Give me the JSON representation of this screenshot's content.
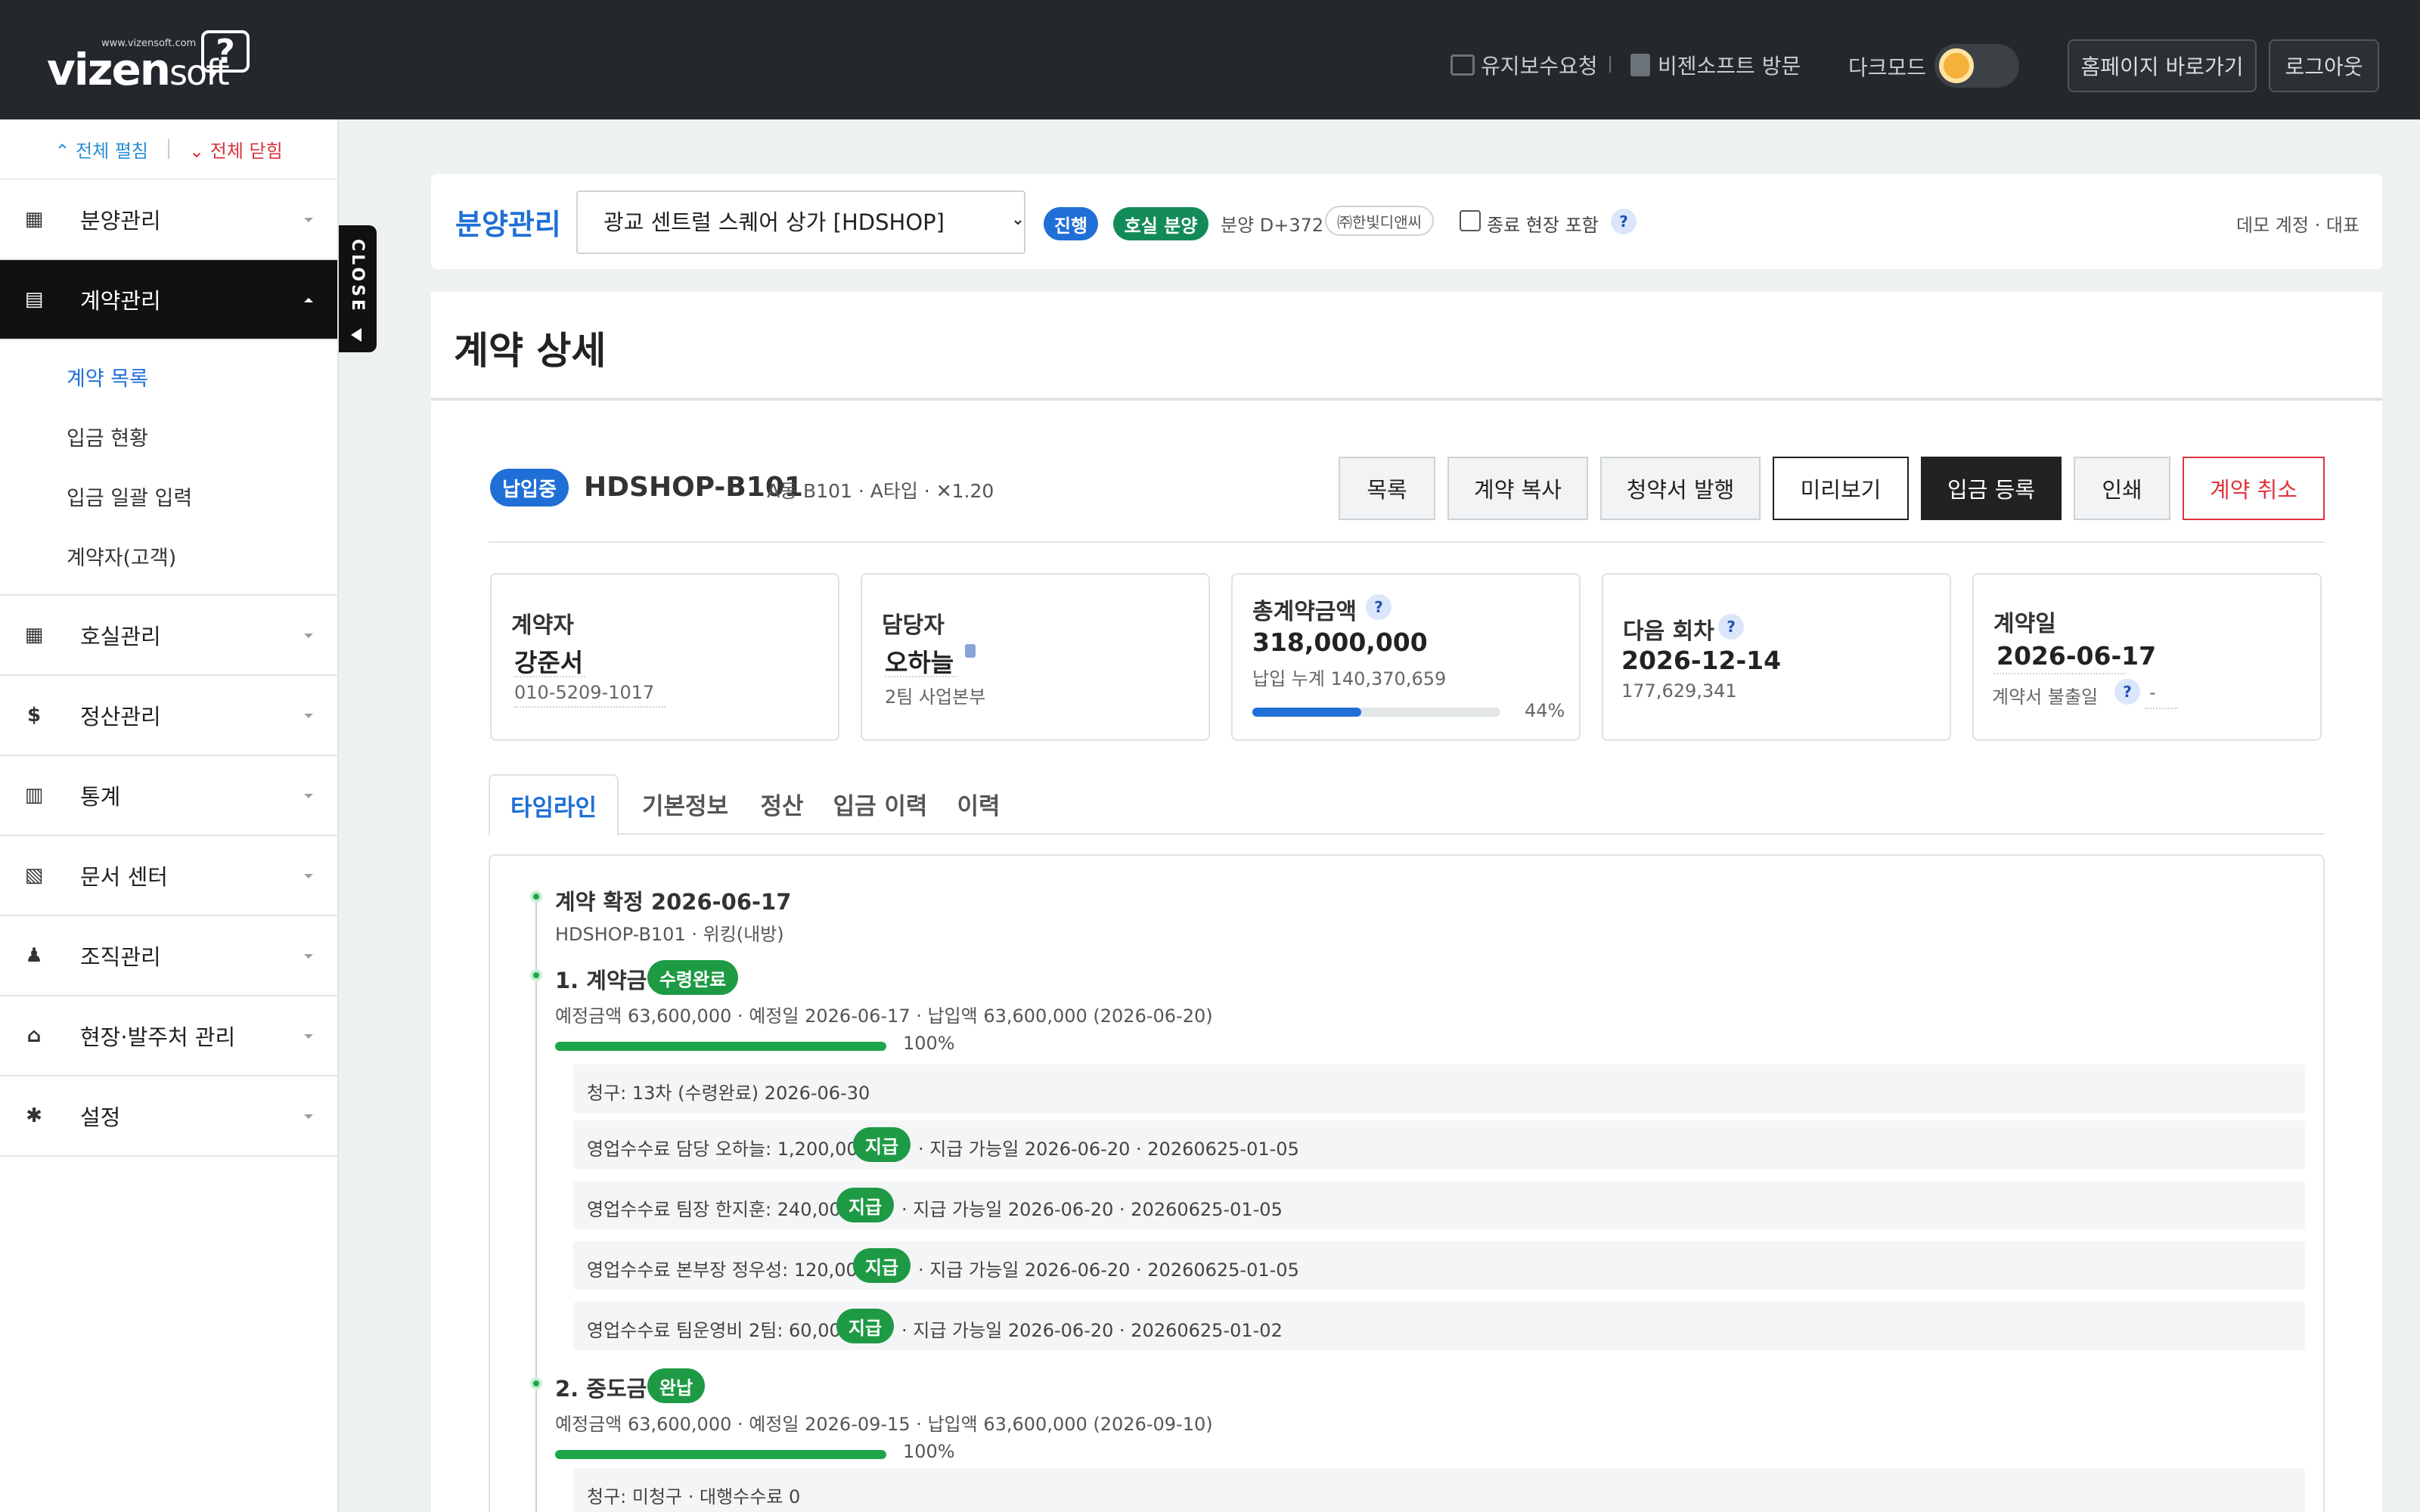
{
  "topbar": {
    "logo_small": "www.vizensoft.com",
    "logo_main": "vizen",
    "logo_soft": "soft",
    "logo_q": "?",
    "maintenance": "유지보수요청",
    "visit": "비젠소프트 방문",
    "darkmode_label": "다크모드",
    "homepage": "홈페이지 바로가기",
    "logout": "로그아웃"
  },
  "sidebar": {
    "expand_all": "⌃ 전체 펼침",
    "collapse_all": "⌄ 전체 닫힘",
    "items": [
      {
        "label": "분양관리",
        "icon": "building-icon"
      },
      {
        "label": "계약관리",
        "icon": "document-icon"
      },
      {
        "label": "호실관리",
        "icon": "grid-icon"
      },
      {
        "label": "정산관리",
        "icon": "dollar-icon"
      },
      {
        "label": "통계",
        "icon": "bar-chart-icon"
      },
      {
        "label": "문서 센터",
        "icon": "pdf-icon"
      },
      {
        "label": "조직관리",
        "icon": "people-icon"
      },
      {
        "label": "현장·발주처 관리",
        "icon": "bank-icon"
      },
      {
        "label": "설정",
        "icon": "settings-icon"
      }
    ],
    "sub": [
      "계약 목록",
      "입금 현황",
      "입금 일괄 입력",
      "계약자(고객)"
    ],
    "close_tab": "CLOSE"
  },
  "header": {
    "title": "분양관리",
    "site_selected": "광교 센트럴 스퀘어 상가 [HDSHOP]",
    "pill_progress": "진행",
    "pill_sale": "호실 분양",
    "dplus": "분양 D+372",
    "corp": "㈜한빛디앤씨",
    "include_closed": "종료 현장 포함",
    "help": "?",
    "account": "데모 계정 · 대표"
  },
  "page": {
    "title": "계약 상세",
    "status": "납입중",
    "code": "HDSHOP-B101",
    "code_meta": "A동 B101 · A타입 · ✕1.20",
    "buttons": [
      "목록",
      "계약 복사",
      "청약서 발행",
      "미리보기",
      "입금 등록",
      "인쇄",
      "계약 취소"
    ]
  },
  "summary": {
    "contractor_label": "계약자",
    "contractor_name": "강준서",
    "contractor_phone": "010-5209-1017",
    "manager_label": "담당자",
    "manager_name": "오하늘",
    "manager_team": "2팀 사업본부",
    "total_label": "총계약금액",
    "total_value": "318,000,000",
    "paid_sum": "납입 누계 140,370,659",
    "paid_ratio": 0.44,
    "paid_pct": "44%",
    "next_label": "다음 회차",
    "next_date": "2026-12-14",
    "next_amount": "177,629,341",
    "contract_label": "계약일",
    "contract_date": "2026-06-17",
    "contract_submit": "계약서 불출일",
    "contract_submit_val": "-"
  },
  "tabs": [
    "타임라인",
    "기본정보",
    "정산",
    "입금 이력",
    "이력"
  ],
  "timeline": {
    "confirm_title": "계약 확정 2026-06-17",
    "confirm_meta": "HDSHOP-B101 · 위킹(내방)",
    "s1_title": "1. 계약금",
    "s1_badge": "수령완료",
    "s1_meta": "예정금액 63,600,000 · 예정일 2026-06-17 · 납입액 63,600,000 (2026-06-20)",
    "s1_pct": "100%",
    "s1_ratio": 1.0,
    "s1_rows": [
      {
        "text": "청구: 13차 (수령완료) 2026-06-30"
      },
      {
        "text": "영업수수료 담당 오하늘: 1,200,000",
        "badge": "지급",
        "tail": "· 지급 가능일 2026-06-20 · 20260625-01-05"
      },
      {
        "text": "영업수수료 팀장 한지훈: 240,000",
        "badge": "지급",
        "tail": "· 지급 가능일 2026-06-20 · 20260625-01-05"
      },
      {
        "text": "영업수수료 본부장 정우성: 120,000",
        "badge": "지급",
        "tail": "· 지급 가능일 2026-06-20 · 20260625-01-05"
      },
      {
        "text": "영업수수료 팀운영비 2팀: 60,000",
        "badge": "지급",
        "tail": "· 지급 가능일 2026-06-20 · 20260625-01-02"
      }
    ],
    "s2_title": "2. 중도금",
    "s2_badge": "완납",
    "s2_meta": "예정금액 63,600,000 · 예정일 2026-09-15 · 납입액 63,600,000 (2026-09-10)",
    "s2_pct": "100%",
    "s2_ratio": 1.0,
    "s2_row": "청구: 미청구 · 대행수수료 0"
  }
}
